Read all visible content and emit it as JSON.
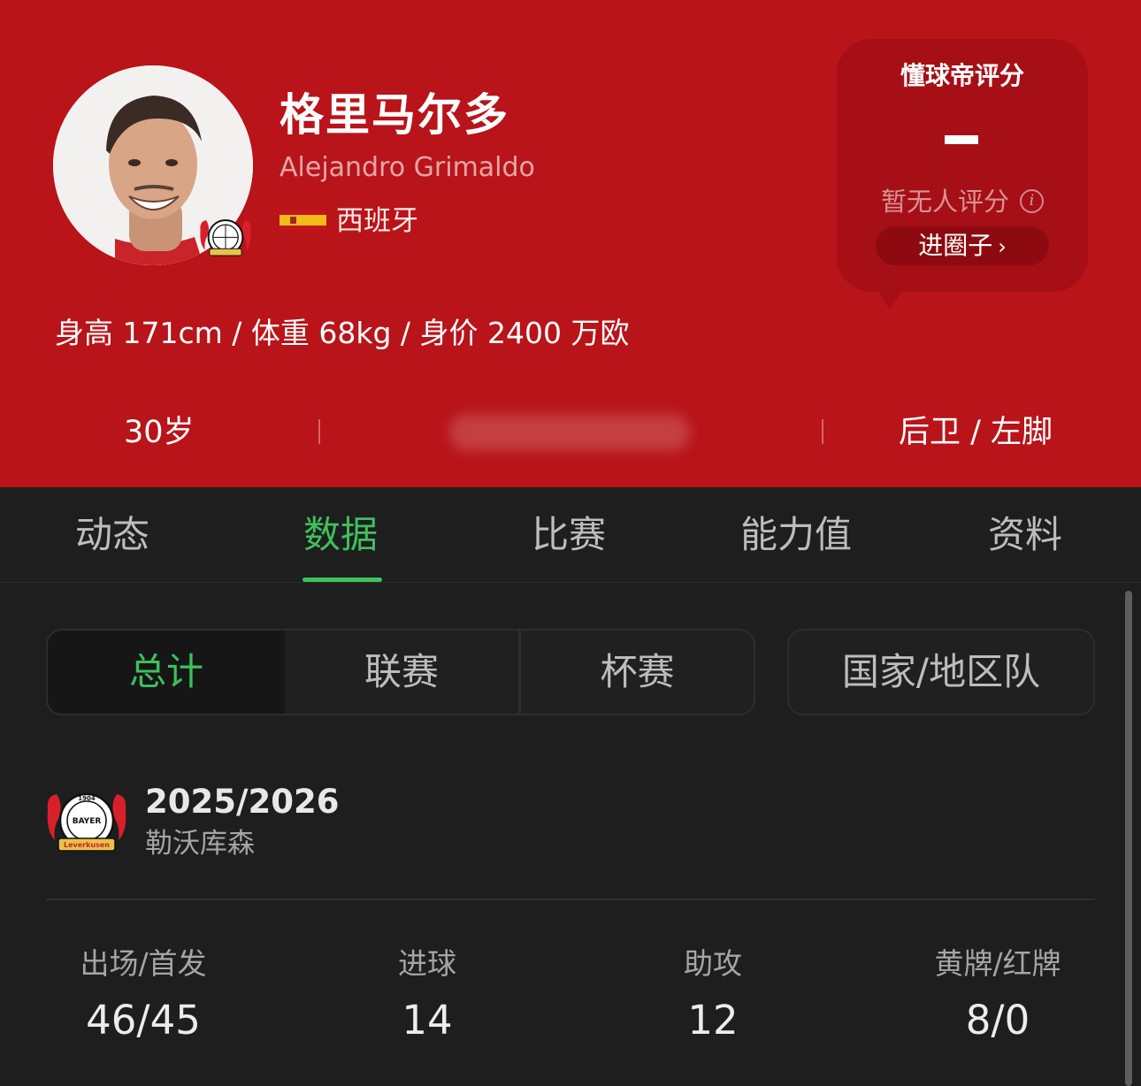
{
  "player": {
    "name_cn": "格里马尔多",
    "name_en": "Alejandro Grimaldo",
    "nationality": "西班牙",
    "body_info": "身高 171cm / 体重 68kg / 身价 2400 万欧",
    "age": "30岁",
    "position_foot": "后卫 / 左脚"
  },
  "rating": {
    "title": "懂球帝评分",
    "value": "—",
    "none_text": "暂无人评分",
    "join_label": "进圈子",
    "join_chevron": "›"
  },
  "tabs": [
    {
      "label": "动态"
    },
    {
      "label": "数据",
      "active": true
    },
    {
      "label": "比赛"
    },
    {
      "label": "能力值"
    },
    {
      "label": "资料"
    }
  ],
  "filters": [
    {
      "label": "总计",
      "active": true
    },
    {
      "label": "联赛"
    },
    {
      "label": "杯赛"
    },
    {
      "label": "国家/地区队"
    }
  ],
  "season": {
    "years": "2025/2026",
    "club": "勒沃库森",
    "crest_year": "1904",
    "crest_brand": "BAYER",
    "crest_city": "Leverkusen"
  },
  "stats": [
    {
      "label": "出场/首发",
      "value": "46/45"
    },
    {
      "label": "进球",
      "value": "14"
    },
    {
      "label": "助攻",
      "value": "12"
    },
    {
      "label": "黄牌/红牌",
      "value": "8/0"
    }
  ],
  "colors": {
    "header_red": "#b81419",
    "accent_green": "#3ec05c",
    "background": "#1e1e1e"
  },
  "icons": {
    "flag": "spain-flag-icon",
    "info": "info-icon",
    "crest": "leverkusen-crest-icon"
  }
}
